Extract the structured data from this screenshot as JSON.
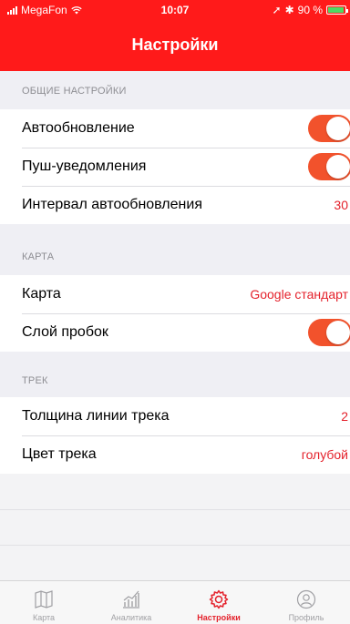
{
  "status": {
    "carrier": "MegaFon",
    "time": "10:07",
    "battery": "90 %"
  },
  "nav": {
    "title": "Настройки"
  },
  "sections": {
    "general": {
      "header": "ОБЩИЕ НАСТРОЙКИ",
      "autoupdate_label": "Автообновление",
      "push_label": "Пуш-уведомления",
      "interval_label": "Интервал автообновления",
      "interval_value": "30"
    },
    "map": {
      "header": "КАРТА",
      "map_label": "Карта",
      "map_value": "Google стандарт",
      "traffic_label": "Слой пробок"
    },
    "track": {
      "header": "ТРЕК",
      "width_label": "Толщина линии трека",
      "width_value": "2",
      "color_label": "Цвет трека",
      "color_value": "голубой"
    }
  },
  "toggles": {
    "autoupdate": true,
    "push": true,
    "traffic": true
  },
  "tabs": [
    {
      "label": "Карта",
      "icon": "map-icon"
    },
    {
      "label": "Аналитика",
      "icon": "chart-icon"
    },
    {
      "label": "Настройки",
      "icon": "gear-icon",
      "active": true
    },
    {
      "label": "Профиль",
      "icon": "profile-icon"
    }
  ],
  "colors": {
    "brand": "#ff1a1a",
    "accent": "#e4212b",
    "toggle_on": "#f2522c"
  }
}
